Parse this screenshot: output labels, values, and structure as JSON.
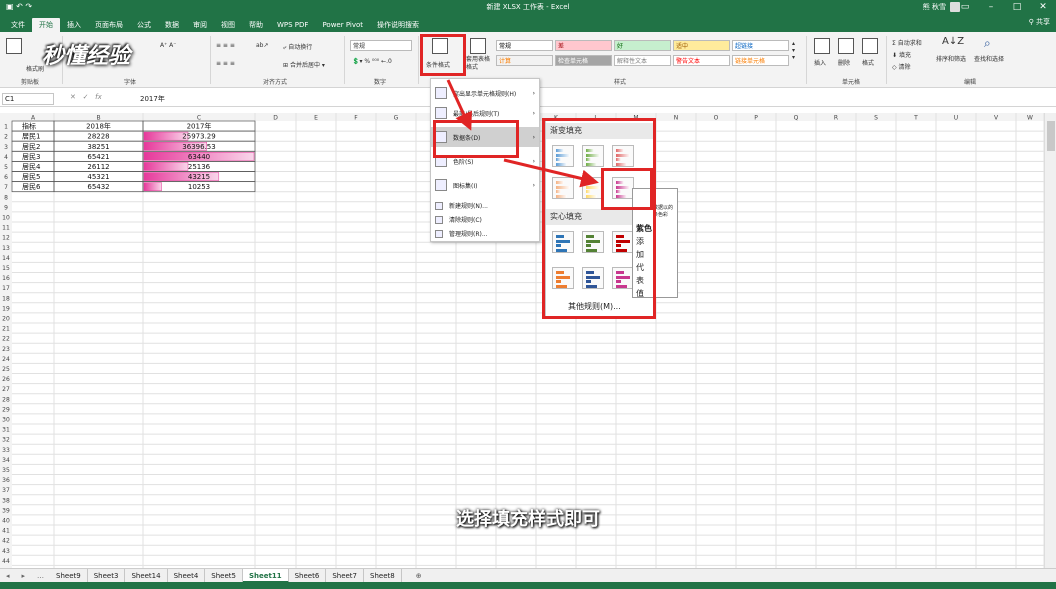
{
  "window": {
    "title": "新建 XLSX 工作表 - Excel",
    "user": "熊 秋雪"
  },
  "ribbon_tabs": [
    "文件",
    "开始",
    "插入",
    "页面布局",
    "公式",
    "数据",
    "审阅",
    "视图",
    "帮助",
    "WPS PDF",
    "Power Pivot",
    "操作说明搜索"
  ],
  "active_tab": "开始",
  "share": "共享",
  "logo": "秒懂经验",
  "ribbon": {
    "clipboard": {
      "label": "剪贴板",
      "format_painter": "格式刷"
    },
    "font": {
      "label": "字体"
    },
    "alignment": {
      "label": "对齐方式",
      "wrap": "自动换行",
      "merge": "合并后居中"
    },
    "number": {
      "label": "数字",
      "format": "常规",
      "percent": "%"
    },
    "styles": {
      "label": "样式",
      "conditional": "条件格式",
      "table": "套用表格格式",
      "cells": [
        {
          "text": "常规",
          "bg": "#ffffff",
          "fg": "#000000"
        },
        {
          "text": "差",
          "bg": "#ffc7ce",
          "fg": "#9c0006"
        },
        {
          "text": "好",
          "bg": "#c6efce",
          "fg": "#006100"
        },
        {
          "text": "适中",
          "bg": "#ffeb9c",
          "fg": "#9c5700"
        },
        {
          "text": "超链接",
          "bg": "#ffffff",
          "fg": "#0563c1"
        },
        {
          "text": "计算",
          "bg": "#f2f2f2",
          "fg": "#fa7d00"
        },
        {
          "text": "检查单元格",
          "bg": "#a5a5a5",
          "fg": "#ffffff"
        },
        {
          "text": "解释性文本",
          "bg": "#ffffff",
          "fg": "#7f7f7f"
        },
        {
          "text": "警告文本",
          "bg": "#ffffff",
          "fg": "#ff0000"
        },
        {
          "text": "链接单元格",
          "bg": "#ffffff",
          "fg": "#fa7d00"
        }
      ]
    },
    "cells_group": {
      "label": "单元格",
      "insert": "插入",
      "delete": "删除",
      "format": "格式"
    },
    "editing": {
      "label": "编辑",
      "autosum": "自动求和",
      "fill": "填充",
      "clear": "清除",
      "sort": "排序和筛选",
      "find": "查找和选择"
    }
  },
  "formula_bar": {
    "name_box": "C1",
    "fx": "fx",
    "content": "2017年"
  },
  "columns": [
    "A",
    "B",
    "C",
    "D",
    "E",
    "F",
    "G",
    "H",
    "I",
    "J",
    "K",
    "L",
    "M",
    "N",
    "O",
    "P",
    "Q",
    "R",
    "S",
    "T",
    "U",
    "V",
    "W"
  ],
  "table": {
    "headers": [
      "指标",
      "2018年",
      "2017年"
    ],
    "rows": [
      {
        "label": "居民1",
        "b": "28228",
        "c": "25973.29",
        "bar": 0.4
      },
      {
        "label": "居民2",
        "b": "38251",
        "c": "36396.53",
        "bar": 0.57
      },
      {
        "label": "居民3",
        "b": "65421",
        "c": "63440",
        "bar": 1.0
      },
      {
        "label": "居民4",
        "b": "26112",
        "c": "25136",
        "bar": 0.4
      },
      {
        "label": "居民5",
        "b": "45321",
        "c": "43215",
        "bar": 0.68
      },
      {
        "label": "居民6",
        "b": "65432",
        "c": "10253",
        "bar": 0.16
      }
    ],
    "bar_color": "#e6399b"
  },
  "cf_menu": {
    "items": [
      "突出显示单元格规则(H)",
      "最前/最后规则(T)",
      "数据条(D)",
      "色阶(S)",
      "图标集(I)"
    ],
    "small_items": [
      "新建规则(N)...",
      "清除规则(C)",
      "管理规则(R)..."
    ]
  },
  "submenu": {
    "gradient": "渐变填充",
    "solid": "实心填充",
    "more": "其他规则(M)...",
    "gradient_colors": [
      "#5b9bd5",
      "#70ad47",
      "#e06666",
      "#f4b183",
      "#ffd966",
      "#c8378e"
    ],
    "solid_colors": [
      "#2e75b6",
      "#548235",
      "#c00000",
      "#ed7d31",
      "#2f5597",
      "#c8378e"
    ]
  },
  "tooltip": {
    "title": "紫色",
    "body": "添加代表值的长",
    "small": "数据以的 条色彩"
  },
  "sheets": [
    "Sheet9",
    "Sheet3",
    "Sheet14",
    "Sheet4",
    "Sheet5",
    "Sheet11",
    "Sheet6",
    "Sheet7",
    "Sheet8"
  ],
  "active_sheet": "Sheet11",
  "caption": "选择填充样式即可"
}
